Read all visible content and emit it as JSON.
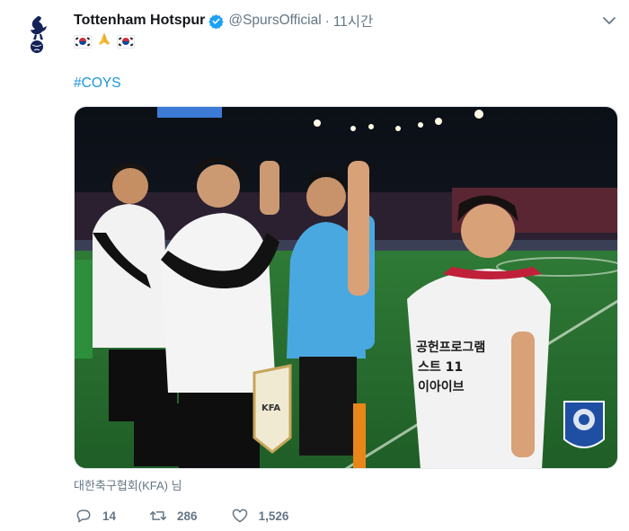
{
  "tweet": {
    "author_name": "Tottenham Hotspur",
    "handle": "@SpursOfficial",
    "separator": "·",
    "time": "11시간",
    "hashtag": "#COYS",
    "photo_credit": "대한축구협회(KFA) 님",
    "image_text": {
      "shirt_line1": "공헌프로그램",
      "shirt_line2": "스트 11",
      "shirt_line3": "이아이브",
      "sleeve_tag": "KFA"
    }
  },
  "actions": {
    "reply_count": "14",
    "retweet_count": "286",
    "like_count": "1,526"
  },
  "colors": {
    "link": "#1b95e0",
    "muted": "#657786",
    "verified": "#1da1f2"
  },
  "icons": [
    "spurs-logo-icon",
    "verified-badge-icon",
    "chevron-down-icon",
    "korea-flag-icon",
    "praying-hands-icon",
    "reply-icon",
    "retweet-icon",
    "like-icon"
  ]
}
